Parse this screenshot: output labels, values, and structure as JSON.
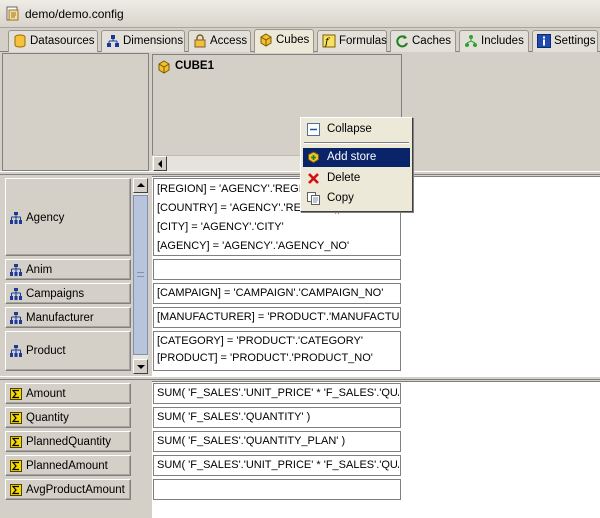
{
  "window": {
    "title": "demo/demo.config"
  },
  "tabs": [
    {
      "label": "Datasources",
      "icon": "datasource-icon"
    },
    {
      "label": "Dimensions",
      "icon": "hierarchy-icon"
    },
    {
      "label": "Access",
      "icon": "lock-icon"
    },
    {
      "label": "Cubes",
      "icon": "cube-icon",
      "active": true
    },
    {
      "label": "Formulas",
      "icon": "formula-icon"
    },
    {
      "label": "Caches",
      "icon": "refresh-icon"
    },
    {
      "label": "Includes",
      "icon": "include-icon"
    },
    {
      "label": "Settings",
      "icon": "info-icon"
    }
  ],
  "cube": {
    "name": "CUBE1"
  },
  "context_menu": {
    "items": [
      {
        "label": "Collapse",
        "icon": "collapse-icon"
      },
      {
        "label": "Add store",
        "icon": "add-store-icon",
        "selected": true
      },
      {
        "label": "Delete",
        "icon": "delete-icon"
      },
      {
        "label": "Copy",
        "icon": "copy-icon"
      }
    ]
  },
  "dimensions": [
    {
      "name": "Agency",
      "mappings": [
        "[REGION] = 'AGENCY'.'REGION'",
        "[COUNTRY] = 'AGENCY'.'REGION' || 'AGENCY'",
        "[CITY] = 'AGENCY'.'CITY'",
        "[AGENCY] = 'AGENCY'.'AGENCY_NO'"
      ]
    },
    {
      "name": "Anim",
      "mappings": []
    },
    {
      "name": "Campaigns",
      "mappings": [
        "[CAMPAIGN] = 'CAMPAIGN'.'CAMPAIGN_NO'"
      ]
    },
    {
      "name": "Manufacturer",
      "mappings": [
        "[MANUFACTURER] = 'PRODUCT'.'MANUFACTURER'"
      ]
    },
    {
      "name": "Product",
      "mappings": [
        "[CATEGORY] = 'PRODUCT'.'CATEGORY'",
        "[PRODUCT] = 'PRODUCT'.'PRODUCT_NO'"
      ]
    }
  ],
  "measures": [
    {
      "name": "Amount",
      "formula": "SUM( 'F_SALES'.'UNIT_PRICE' * 'F_SALES'.'QUANTITY' )"
    },
    {
      "name": "Quantity",
      "formula": "SUM( 'F_SALES'.'QUANTITY' )"
    },
    {
      "name": "PlannedQuantity",
      "formula": "SUM( 'F_SALES'.'QUANTITY_PLAN' )"
    },
    {
      "name": "PlannedAmount",
      "formula": "SUM( 'F_SALES'.'UNIT_PRICE' * 'F_SALES'.'QUANTITY_PLAN' )"
    },
    {
      "name": "AvgProductAmount",
      "formula": ""
    }
  ],
  "colors": {
    "accent": "#0a246a",
    "dimension_icon": "#1a3a9a",
    "measure_icon": "#e8c800",
    "cube_icon": "#e8b400"
  }
}
